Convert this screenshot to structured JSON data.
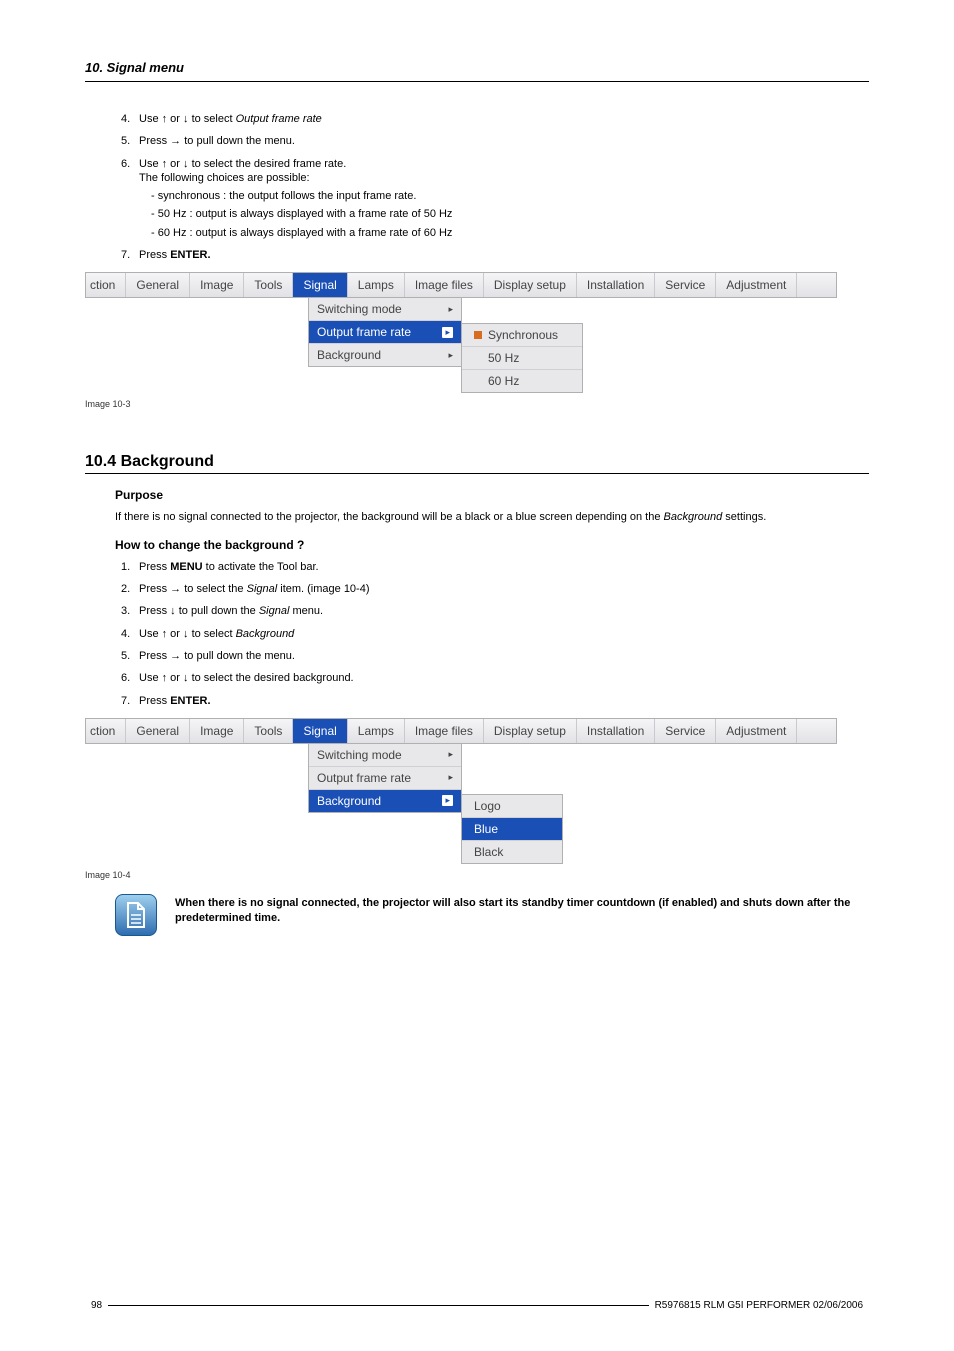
{
  "chapter": "10.  Signal menu",
  "steps1": {
    "s4": {
      "n": "4.",
      "t": "Use ↑ or ↓ to select ",
      "i": "Output frame rate"
    },
    "s5": {
      "n": "5.",
      "t": "Press → to pull down the menu."
    },
    "s6": {
      "n": "6.",
      "t1": "Use ↑ or ↓ to select the desired frame rate.",
      "t2": "The following choices are possible:"
    },
    "s6sub": {
      "a": "synchronous :  the output follows the input frame rate.",
      "b": "50 Hz :  output is always displayed with a frame rate of 50 Hz",
      "c": "60 Hz :  output is always displayed with a frame rate of 60 Hz"
    },
    "s7": {
      "n": "7.",
      "t": "Press ",
      "b": "ENTER."
    }
  },
  "menubar": {
    "ction": "ction",
    "general": "General",
    "image": "Image",
    "tools": "Tools",
    "signal": "Signal",
    "lamps": "Lamps",
    "imagefiles": "Image files",
    "displaysetup": "Display setup",
    "installation": "Installation",
    "service": "Service",
    "adjustment": "Adjustment"
  },
  "dropdown1": {
    "switching": "Switching mode",
    "output": "Output frame rate",
    "background": "Background"
  },
  "submenu1": {
    "sync": "Synchronous",
    "hz50": "50 Hz",
    "hz60": "60 Hz"
  },
  "caption1": "Image 10-3",
  "section104": "10.4  Background",
  "purpose_h": "Purpose",
  "purpose_p1": "If there is no signal connected to the projector, the background will be a black or a blue screen depending on the ",
  "purpose_i": "Background",
  "purpose_p2": " settings.",
  "howto_h": "How to change the background ?",
  "steps2": {
    "s1": {
      "n": "1.",
      "t": "Press ",
      "b": "MENU",
      "t2": " to activate the Tool bar."
    },
    "s2": {
      "n": "2.",
      "t": "Press → to select the ",
      "i": "Signal",
      "t2": " item.  (image 10-4)"
    },
    "s3": {
      "n": "3.",
      "t": "Press ↓ to pull down the ",
      "i": "Signal",
      "t2": " menu."
    },
    "s4": {
      "n": "4.",
      "t": "Use ↑ or ↓ to select ",
      "i": "Background"
    },
    "s5": {
      "n": "5.",
      "t": "Press → to pull down the menu."
    },
    "s6": {
      "n": "6.",
      "t": "Use ↑ or ↓ to select the desired background."
    },
    "s7": {
      "n": "7.",
      "t": "Press ",
      "b": "ENTER."
    }
  },
  "submenu2": {
    "logo": "Logo",
    "blue": "Blue",
    "black": "Black"
  },
  "caption2": "Image 10-4",
  "note": "When there is no signal connected, the projector will also start its standby timer countdown (if enabled) and shuts down after the predetermined time.",
  "footer": {
    "page": "98",
    "doc": "R5976815  RLM G5I PERFORMER  02/06/2006"
  }
}
